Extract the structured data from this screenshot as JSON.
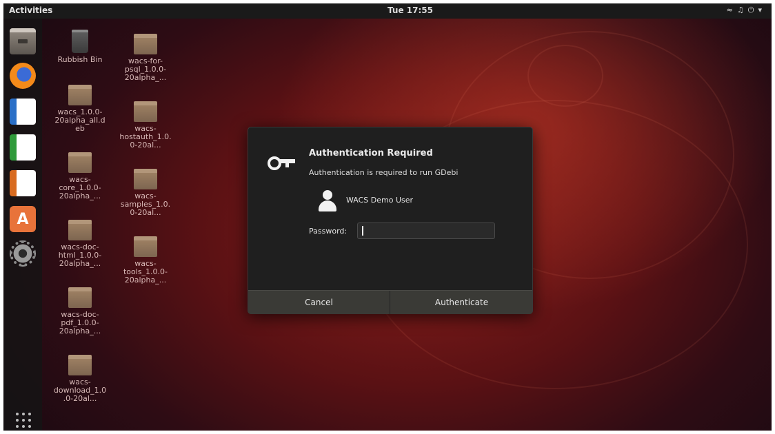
{
  "topbar": {
    "activities": "Activities",
    "clock": "Tue 17:55"
  },
  "dock": {
    "items": [
      "files-icon",
      "firefox-icon",
      "writer-icon",
      "calc-icon",
      "impress-icon",
      "software-icon",
      "settings-icon",
      "show-applications-icon"
    ],
    "software_glyph": "A"
  },
  "desktop": {
    "icons": [
      {
        "label": "Rubbish Bin",
        "type": "bin"
      },
      {
        "label": "wacs_1.0.0-20alpha_all.deb",
        "type": "package"
      },
      {
        "label": "wacs-core_1.0.0-20alpha_...",
        "type": "package"
      },
      {
        "label": "wacs-doc-html_1.0.0-20alpha_...",
        "type": "package"
      },
      {
        "label": "wacs-doc-pdf_1.0.0-20alpha_...",
        "type": "package"
      },
      {
        "label": "wacs-download_1.0.0-20al...",
        "type": "package"
      },
      {
        "label": "wacs-for-psql_1.0.0-20alpha_...",
        "type": "package"
      },
      {
        "label": "wacs-hostauth_1.0.0-20al...",
        "type": "package"
      },
      {
        "label": "wacs-samples_1.0.0-20al...",
        "type": "package"
      },
      {
        "label": "wacs-tools_1.0.0-20alpha_...",
        "type": "package"
      }
    ]
  },
  "dialog": {
    "title": "Authentication Required",
    "message": "Authentication is required to run GDebi",
    "user": "WACS Demo User",
    "password_label": "Password:",
    "password_value": "",
    "cancel": "Cancel",
    "authenticate": "Authenticate"
  },
  "colors": {
    "topbar": "#1a1a1a",
    "dialog_bg": "#1f1f1f",
    "button_row": "#3a3a36",
    "wallpaper_red": "#8a1f1a"
  }
}
